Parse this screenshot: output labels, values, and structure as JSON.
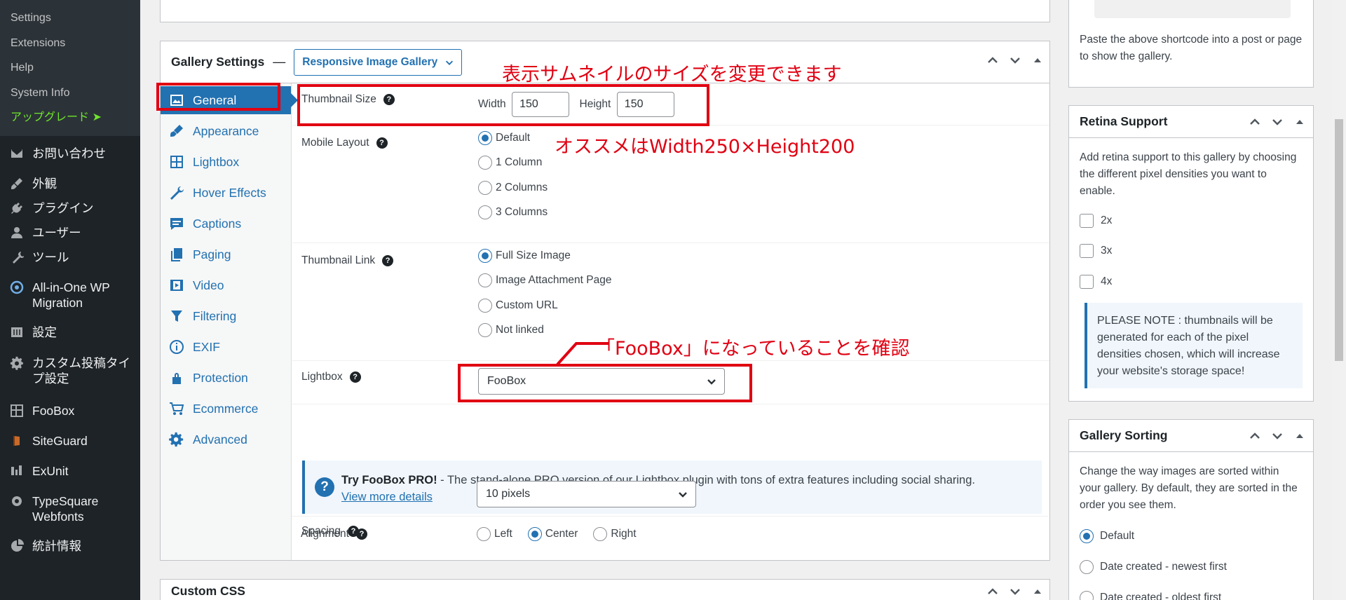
{
  "admin_menu": {
    "submenu": [
      "Settings",
      "Extensions",
      "Help",
      "System Info"
    ],
    "upgrade": "アップグレード ➤",
    "items": [
      {
        "icon": "mail-icon",
        "label": "お問い合わせ"
      },
      {
        "icon": "paintbrush-icon",
        "label": "外観"
      },
      {
        "icon": "plugin-icon",
        "label": "プラグイン"
      },
      {
        "icon": "user-icon",
        "label": "ユーザー"
      },
      {
        "icon": "wrench-icon",
        "label": "ツール"
      },
      {
        "icon": "migration-icon",
        "label": "All-in-One WP Migration"
      },
      {
        "icon": "settings-icon",
        "label": "設定"
      },
      {
        "icon": "gear-icon",
        "label": "カスタム投稿タイプ設定"
      },
      {
        "icon": "grid-icon",
        "label": "FooBox"
      },
      {
        "icon": "shield-icon",
        "label": "SiteGuard"
      },
      {
        "icon": "exunit-icon",
        "label": "ExUnit"
      },
      {
        "icon": "gear-icon",
        "label": "TypeSquare Webfonts"
      },
      {
        "icon": "pie-chart-icon",
        "label": "統計情報"
      }
    ]
  },
  "settings_box": {
    "title": "Gallery Settings",
    "dash": "—",
    "gallery_type": "Responsive Image Gallery",
    "tabs": [
      "General",
      "Appearance",
      "Lightbox",
      "Hover Effects",
      "Captions",
      "Paging",
      "Video",
      "Filtering",
      "EXIF",
      "Protection",
      "Ecommerce",
      "Advanced"
    ],
    "active_tab": "General",
    "thumbnail_size": {
      "label": "Thumbnail Size",
      "width_label": "Width",
      "width_value": "150",
      "height_label": "Height",
      "height_value": "150"
    },
    "mobile_layout": {
      "label": "Mobile Layout",
      "options": [
        "Default",
        "1 Column",
        "2 Columns",
        "3 Columns"
      ],
      "selected": "Default"
    },
    "thumbnail_link": {
      "label": "Thumbnail Link",
      "options": [
        "Full Size Image",
        "Image Attachment Page",
        "Custom URL",
        "Not linked"
      ],
      "selected": "Full Size Image"
    },
    "lightbox": {
      "label": "Lightbox",
      "value": "FooBox"
    },
    "notice": {
      "icon": "question-icon",
      "bold": "Try FooBox PRO!",
      "text": " - The stand-alone PRO version of our Lightbox plugin with tons of extra features including social sharing.",
      "link": "View more details"
    },
    "spacing": {
      "label": "Spacing",
      "value": "10 pixels"
    },
    "alignment": {
      "label": "Alignment",
      "options": [
        "Left",
        "Center",
        "Right"
      ],
      "selected": "Center"
    }
  },
  "custom_css_box": {
    "title": "Custom CSS"
  },
  "sidebar": {
    "shortcode_hint": "Paste the above shortcode into a post or page to show the gallery.",
    "retina": {
      "title": "Retina Support",
      "description": "Add retina support to this gallery by choosing the different pixel densities you want to enable.",
      "options": [
        "2x",
        "3x",
        "4x"
      ],
      "note": "PLEASE NOTE : thumbnails will be generated for each of the pixel densities chosen, which will increase your website's storage space!"
    },
    "sorting": {
      "title": "Gallery Sorting",
      "description": "Change the way images are sorted within your gallery. By default, they are sorted in the order you see them.",
      "options": [
        "Default",
        "Date created - newest first",
        "Date created - oldest first"
      ],
      "selected": "Default"
    }
  },
  "annotations": {
    "size_note": "表示サムネイルのサイズを変更できます",
    "recommend_note": "オススメはWidth250×Height200",
    "foobox_note": "「FooBox」になっていることを確認",
    "accent_color": "#e00012"
  }
}
